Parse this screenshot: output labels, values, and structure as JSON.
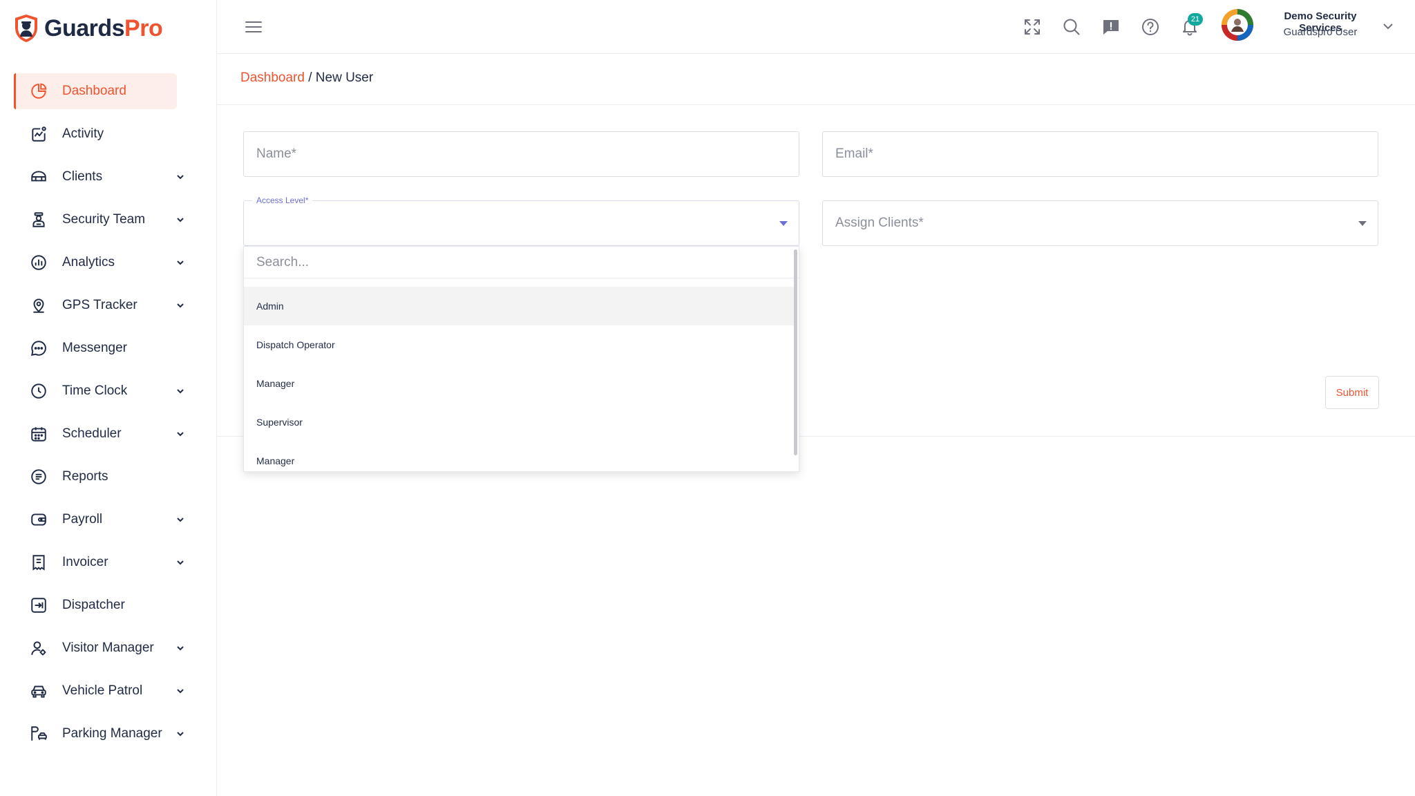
{
  "brand": {
    "name_part1": "Guards",
    "name_part2": "Pro",
    "accent": "#f0532f"
  },
  "sidebar": {
    "items": [
      {
        "label": "Dashboard",
        "icon": "pie-chart-icon",
        "active": true,
        "expandable": false
      },
      {
        "label": "Activity",
        "icon": "activity-icon",
        "expandable": false
      },
      {
        "label": "Clients",
        "icon": "clients-icon",
        "expandable": true
      },
      {
        "label": "Security Team",
        "icon": "guard-icon",
        "expandable": true
      },
      {
        "label": "Analytics",
        "icon": "analytics-icon",
        "expandable": true
      },
      {
        "label": "GPS Tracker",
        "icon": "location-pin-icon",
        "expandable": true
      },
      {
        "label": "Messenger",
        "icon": "chat-icon",
        "expandable": false
      },
      {
        "label": "Time Clock",
        "icon": "clock-icon",
        "expandable": true
      },
      {
        "label": "Scheduler",
        "icon": "calendar-icon",
        "expandable": true
      },
      {
        "label": "Reports",
        "icon": "report-icon",
        "expandable": false
      },
      {
        "label": "Payroll",
        "icon": "wallet-icon",
        "expandable": true
      },
      {
        "label": "Invoicer",
        "icon": "invoice-icon",
        "expandable": true
      },
      {
        "label": "Dispatcher",
        "icon": "dispatch-icon",
        "expandable": false
      },
      {
        "label": "Visitor Manager",
        "icon": "visitor-icon",
        "expandable": true
      },
      {
        "label": "Vehicle Patrol",
        "icon": "car-icon",
        "expandable": true
      },
      {
        "label": "Parking Manager",
        "icon": "parking-icon",
        "expandable": true
      }
    ]
  },
  "header": {
    "notification_count": "21",
    "user": {
      "company": "Demo Security Services",
      "role": "Guardspro User"
    }
  },
  "breadcrumb": {
    "parent": "Dashboard",
    "separator": "/",
    "current": "New User"
  },
  "form": {
    "name_placeholder": "Name*",
    "email_placeholder": "Email*",
    "access_level_label": "Access Level*",
    "assign_clients_placeholder": "Assign Clients*",
    "submit_label": "Submit"
  },
  "dropdown": {
    "search_placeholder": "Search...",
    "options": [
      "Admin",
      "Dispatch Operator",
      "Manager",
      "Supervisor",
      "Manager"
    ]
  }
}
